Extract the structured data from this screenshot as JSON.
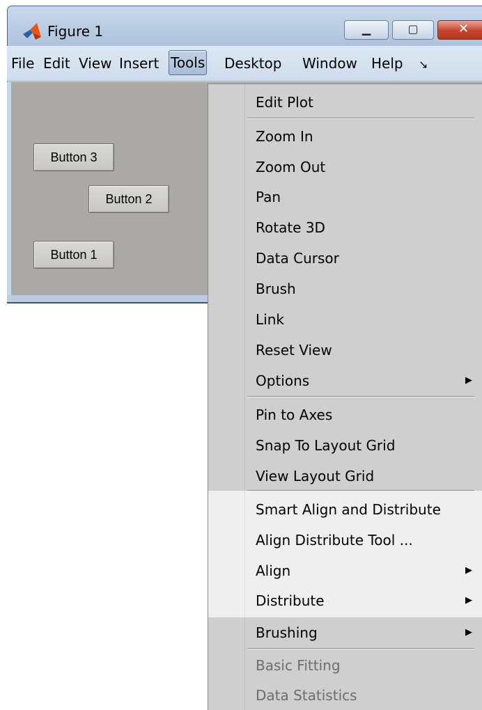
{
  "window": {
    "title": "Figure 1",
    "icon": "matlab-logo-icon",
    "controls": {
      "minimize": "▁",
      "maximize": "▢",
      "close": "✕"
    }
  },
  "menubar": {
    "items": [
      "File",
      "Edit",
      "View",
      "Insert",
      "Tools",
      "Desktop",
      "Window",
      "Help"
    ],
    "active": "Tools",
    "overflow": "↘"
  },
  "figure": {
    "background": "#aaa9a5",
    "buttons": [
      "Button 3",
      "Button 2",
      "Button 1"
    ]
  },
  "tools_menu": {
    "items": [
      {
        "label": "Edit Plot"
      },
      {
        "label": "Zoom In"
      },
      {
        "label": "Zoom Out"
      },
      {
        "label": "Pan"
      },
      {
        "label": "Rotate 3D"
      },
      {
        "label": "Data Cursor"
      },
      {
        "label": "Brush"
      },
      {
        "label": "Link"
      },
      {
        "label": "Reset View"
      },
      {
        "label": "Options",
        "submenu": "▶"
      },
      {
        "label": "Pin to Axes"
      },
      {
        "label": "Snap To Layout Grid"
      },
      {
        "label": "View Layout Grid"
      },
      {
        "label": "Smart Align and Distribute"
      },
      {
        "label": "Align Distribute Tool ..."
      },
      {
        "label": "Align",
        "submenu": "▶"
      },
      {
        "label": "Distribute",
        "submenu": "▶"
      },
      {
        "label": "Brushing",
        "submenu": "▶"
      },
      {
        "label": "Basic Fitting",
        "disabled": true
      },
      {
        "label": "Data Statistics",
        "disabled": true
      }
    ]
  }
}
